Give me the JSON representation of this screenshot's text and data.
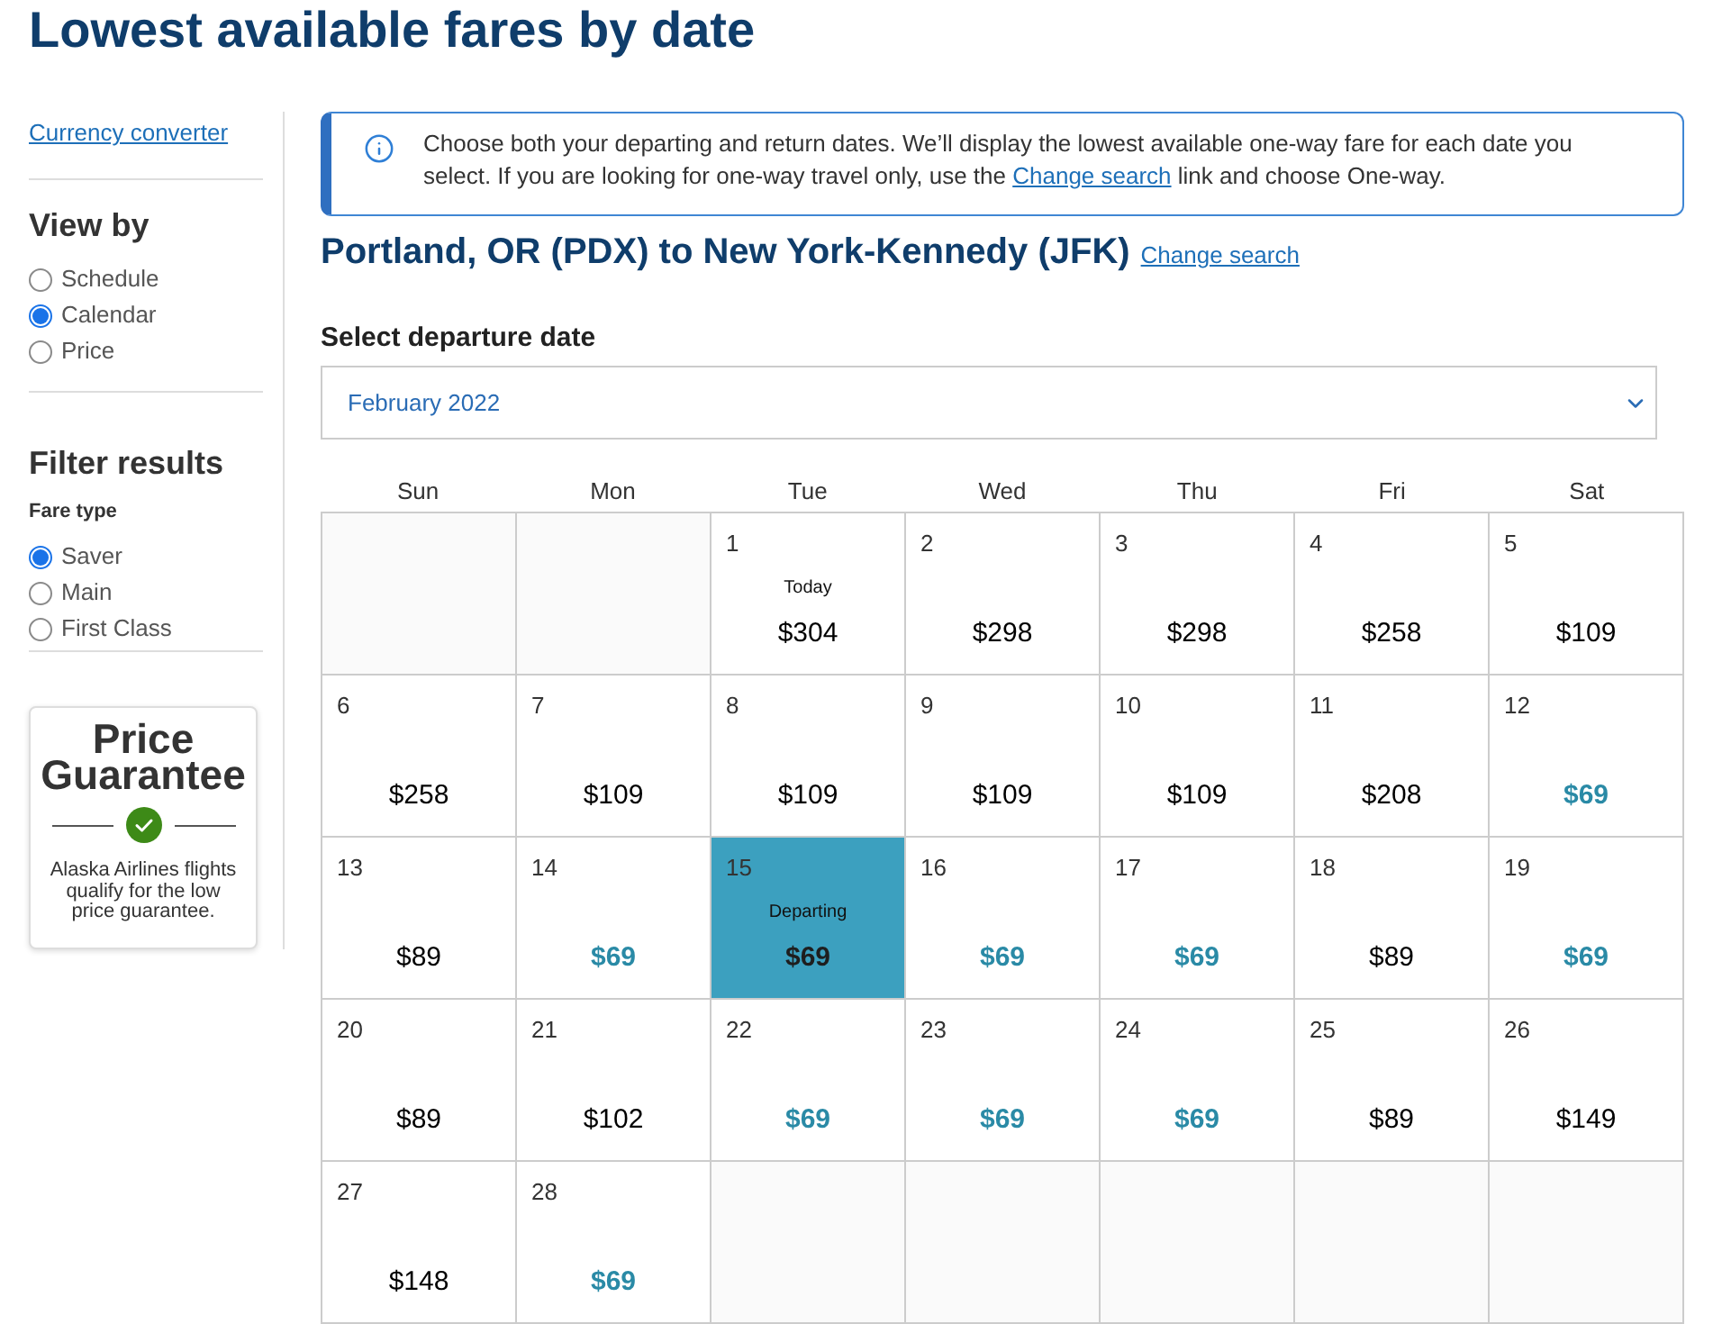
{
  "page": {
    "title": "Lowest available fares by date"
  },
  "sidebar": {
    "currency_link": "Currency converter",
    "view_by": {
      "heading": "View by",
      "options": [
        {
          "label": "Schedule",
          "selected": false
        },
        {
          "label": "Calendar",
          "selected": true
        },
        {
          "label": "Price",
          "selected": false
        }
      ]
    },
    "filter": {
      "heading": "Filter results",
      "fare_type": {
        "label": "Fare type",
        "options": [
          {
            "label": "Saver",
            "selected": true
          },
          {
            "label": "Main",
            "selected": false
          },
          {
            "label": "First Class",
            "selected": false
          }
        ]
      }
    },
    "price_guarantee": {
      "title": "Price Guarantee",
      "text": "Alaska Airlines flights qualify for the low price guarantee."
    }
  },
  "notice": {
    "text_before": "Choose both your departing and return dates. We’ll display the lowest available one-way fare for each date you select. If you are looking for one-way travel only, use the",
    "link": "Change search",
    "text_after": "link and choose One-way."
  },
  "route": {
    "title": "Portland, OR (PDX) to New York-Kennedy (JFK)",
    "link": "Change search"
  },
  "departure": {
    "label": "Select departure date",
    "month": "February 2022"
  },
  "calendar": {
    "weekdays": [
      "Sun",
      "Mon",
      "Tue",
      "Wed",
      "Thu",
      "Fri",
      "Sat"
    ],
    "weeks": [
      [
        {
          "kind": "empty"
        },
        {
          "kind": "empty"
        },
        {
          "kind": "day",
          "day": "1",
          "note": "Today",
          "price": "$304",
          "lowest_fare": false,
          "selected": false
        },
        {
          "kind": "day",
          "day": "2",
          "price": "$298",
          "lowest_fare": false,
          "selected": false
        },
        {
          "kind": "day",
          "day": "3",
          "price": "$298",
          "lowest_fare": false,
          "selected": false
        },
        {
          "kind": "day",
          "day": "4",
          "price": "$258",
          "lowest_fare": false,
          "selected": false
        },
        {
          "kind": "day",
          "day": "5",
          "price": "$109",
          "lowest_fare": false,
          "selected": false
        }
      ],
      [
        {
          "kind": "day",
          "day": "6",
          "price": "$258",
          "lowest_fare": false,
          "selected": false
        },
        {
          "kind": "day",
          "day": "7",
          "price": "$109",
          "lowest_fare": false,
          "selected": false
        },
        {
          "kind": "day",
          "day": "8",
          "price": "$109",
          "lowest_fare": false,
          "selected": false
        },
        {
          "kind": "day",
          "day": "9",
          "price": "$109",
          "lowest_fare": false,
          "selected": false
        },
        {
          "kind": "day",
          "day": "10",
          "price": "$109",
          "lowest_fare": false,
          "selected": false
        },
        {
          "kind": "day",
          "day": "11",
          "price": "$208",
          "lowest_fare": false,
          "selected": false
        },
        {
          "kind": "day",
          "day": "12",
          "price": "$69",
          "lowest_fare": true,
          "selected": false
        }
      ],
      [
        {
          "kind": "day",
          "day": "13",
          "price": "$89",
          "lowest_fare": false,
          "selected": false
        },
        {
          "kind": "day",
          "day": "14",
          "price": "$69",
          "lowest_fare": true,
          "selected": false
        },
        {
          "kind": "day",
          "day": "15",
          "note": "Departing",
          "price": "$69",
          "lowest_fare": true,
          "selected": true
        },
        {
          "kind": "day",
          "day": "16",
          "price": "$69",
          "lowest_fare": true,
          "selected": false
        },
        {
          "kind": "day",
          "day": "17",
          "price": "$69",
          "lowest_fare": true,
          "selected": false
        },
        {
          "kind": "day",
          "day": "18",
          "price": "$89",
          "lowest_fare": false,
          "selected": false
        },
        {
          "kind": "day",
          "day": "19",
          "price": "$69",
          "lowest_fare": true,
          "selected": false
        }
      ],
      [
        {
          "kind": "day",
          "day": "20",
          "price": "$89",
          "lowest_fare": false,
          "selected": false
        },
        {
          "kind": "day",
          "day": "21",
          "price": "$102",
          "lowest_fare": false,
          "selected": false
        },
        {
          "kind": "day",
          "day": "22",
          "price": "$69",
          "lowest_fare": true,
          "selected": false
        },
        {
          "kind": "day",
          "day": "23",
          "price": "$69",
          "lowest_fare": true,
          "selected": false
        },
        {
          "kind": "day",
          "day": "24",
          "price": "$69",
          "lowest_fare": true,
          "selected": false
        },
        {
          "kind": "day",
          "day": "25",
          "price": "$89",
          "lowest_fare": false,
          "selected": false
        },
        {
          "kind": "day",
          "day": "26",
          "price": "$149",
          "lowest_fare": false,
          "selected": false
        }
      ],
      [
        {
          "kind": "day",
          "day": "27",
          "price": "$148",
          "lowest_fare": false,
          "selected": false
        },
        {
          "kind": "day",
          "day": "28",
          "price": "$69",
          "lowest_fare": true,
          "selected": false
        },
        {
          "kind": "empty"
        },
        {
          "kind": "empty"
        },
        {
          "kind": "empty"
        },
        {
          "kind": "empty"
        },
        {
          "kind": "empty"
        }
      ]
    ]
  }
}
